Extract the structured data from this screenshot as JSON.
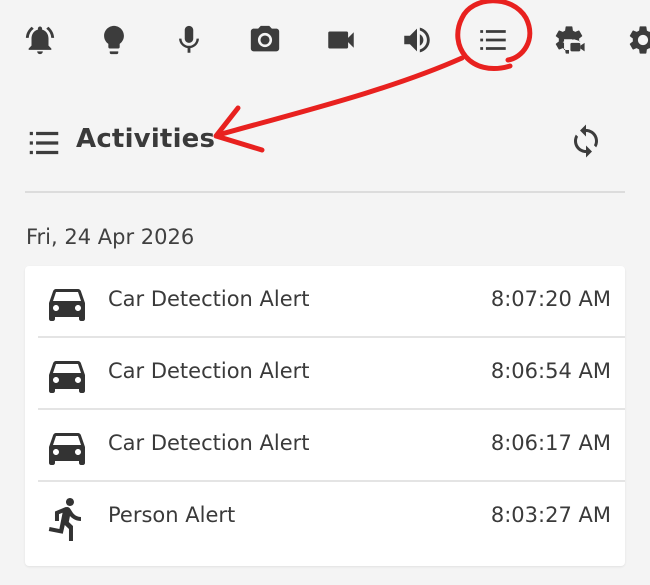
{
  "toolbar": {
    "icons": [
      {
        "name": "alarm-bell-icon"
      },
      {
        "name": "lightbulb-icon"
      },
      {
        "name": "microphone-icon"
      },
      {
        "name": "camera-icon"
      },
      {
        "name": "video-camera-icon"
      },
      {
        "name": "speaker-icon"
      },
      {
        "name": "activities-list-icon"
      },
      {
        "name": "camera-settings-icon"
      },
      {
        "name": "settings-gear-icon"
      }
    ]
  },
  "header": {
    "title": "Activities",
    "refresh_icon": "refresh-icon"
  },
  "date_label": "Fri, 24 Apr 2026",
  "activities": [
    {
      "label": "Car Detection Alert",
      "time": "8:07:20 AM",
      "icon": "car-icon"
    },
    {
      "label": "Car Detection Alert",
      "time": "8:06:54 AM",
      "icon": "car-icon"
    },
    {
      "label": "Car Detection Alert",
      "time": "8:06:17 AM",
      "icon": "car-icon"
    },
    {
      "label": "Person Alert",
      "time": "8:03:27 AM",
      "icon": "person-running-icon"
    }
  ],
  "annotation_color": "#e8211f"
}
